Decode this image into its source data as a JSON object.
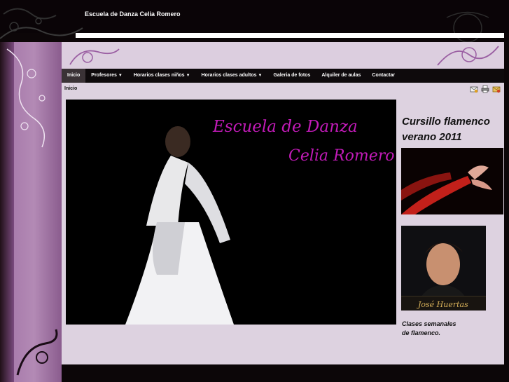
{
  "site": {
    "title": "Escuela de Danza Celia Romero"
  },
  "nav": {
    "items": [
      {
        "label": "Inicio",
        "caret": ""
      },
      {
        "label": "Profesores",
        "caret": "▼"
      },
      {
        "label": "Horarios clases niños",
        "caret": "▼"
      },
      {
        "label": "Horarios clases adultos",
        "caret": "▼"
      },
      {
        "label": "Galeria de fotos",
        "caret": ""
      },
      {
        "label": "Alquiler de aulas",
        "caret": ""
      },
      {
        "label": "Contactar",
        "caret": ""
      }
    ]
  },
  "breadcrumb": "Inicio",
  "toolbar": {
    "icons": [
      "email-icon",
      "print-icon",
      "pdf-icon"
    ]
  },
  "hero": {
    "line1": "Escuela de Danza",
    "line2": "Celia Romero"
  },
  "sidebar": {
    "heading_line1": "Cursillo flamenco",
    "heading_line2": "verano 2011",
    "teacher_caption": "José Huertas",
    "text_line1": "Clases semanales",
    "text_line2": "de flamenco."
  },
  "colors": {
    "accent": "#c21bb8",
    "background": "#0c0608",
    "panel": "#ddd2e0",
    "nav": "#0e0a0c",
    "left_panel": "#a273a6"
  }
}
